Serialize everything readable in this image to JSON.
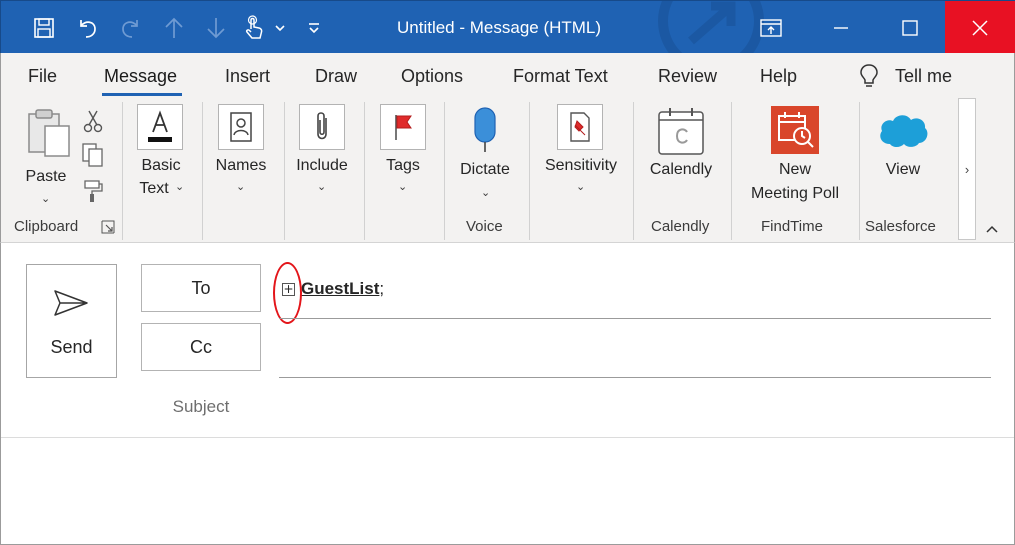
{
  "window": {
    "title": "Untitled  -  Message (HTML)"
  },
  "quick_access": [
    "save-icon",
    "undo-icon",
    "redo-icon",
    "up-arrow-icon",
    "down-arrow-icon",
    "touch-mode-icon",
    "dropdown-icon",
    "customize-icon"
  ],
  "menu": {
    "tabs": [
      "File",
      "Message",
      "Insert",
      "Draw",
      "Options",
      "Format Text",
      "Review",
      "Help"
    ],
    "active": "Message",
    "tell_me": "Tell me"
  },
  "ribbon": {
    "paste": "Paste",
    "basic_text": [
      "Basic",
      "Text"
    ],
    "names": "Names",
    "include": "Include",
    "tags": "Tags",
    "dictate": "Dictate",
    "sensitivity": "Sensitivity",
    "calendly": "Calendly",
    "new_meeting_poll": [
      "New",
      "Meeting Poll"
    ],
    "view": "View",
    "groups": {
      "clipboard": "Clipboard",
      "voice": "Voice",
      "calendly": "Calendly",
      "findtime": "FindTime",
      "salesforce": "Salesforce"
    }
  },
  "compose": {
    "send": "Send",
    "to": "To",
    "cc": "Cc",
    "subject": "Subject",
    "recipient": "GuestList",
    "recipient_sep": ";"
  },
  "colors": {
    "titlebar": "#1f62b3",
    "close": "#e81123",
    "annotation": "#e3151a",
    "findtime_orange": "#d9462b",
    "salesforce_blue": "#1d9fd8"
  }
}
